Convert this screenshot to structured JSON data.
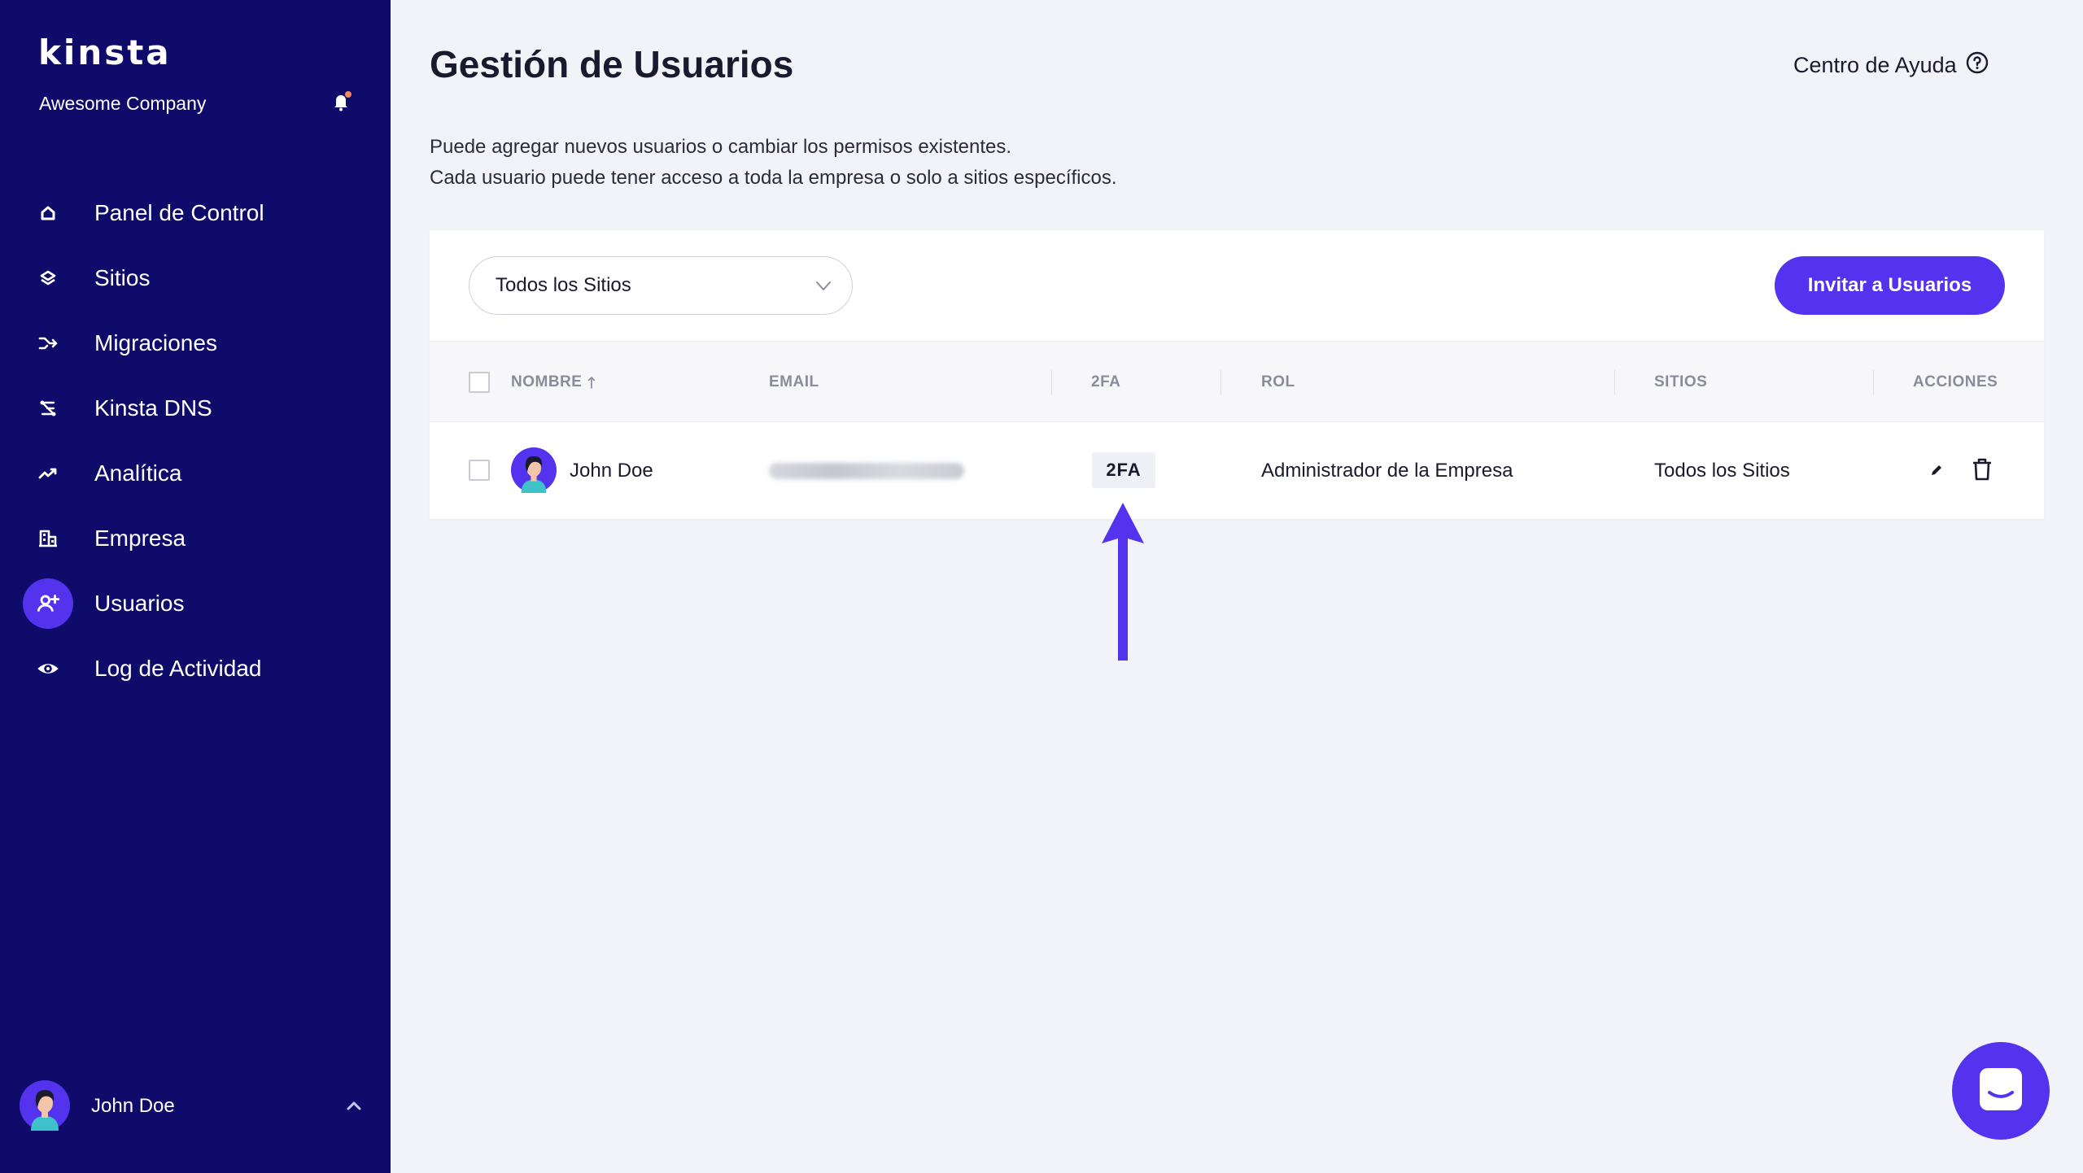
{
  "sidebar": {
    "logo": "kinsta",
    "company": "Awesome Company",
    "items": [
      {
        "label": "Panel de Control",
        "icon": "home-icon"
      },
      {
        "label": "Sitios",
        "icon": "layers-icon"
      },
      {
        "label": "Migraciones",
        "icon": "migrate-icon"
      },
      {
        "label": "Kinsta DNS",
        "icon": "dns-icon"
      },
      {
        "label": "Analítica",
        "icon": "analytics-icon"
      },
      {
        "label": "Empresa",
        "icon": "building-icon"
      },
      {
        "label": "Usuarios",
        "icon": "user-add-icon",
        "active": true
      },
      {
        "label": "Log de Actividad",
        "icon": "eye-icon"
      }
    ],
    "user": {
      "name": "John Doe"
    }
  },
  "header": {
    "title": "Gestión de Usuarios",
    "help": "Centro de Ayuda"
  },
  "description": {
    "line1": "Puede agregar nuevos usuarios o cambiar los permisos existentes.",
    "line2": "Cada usuario puede tener acceso a toda la empresa o solo a sitios específicos."
  },
  "toolbar": {
    "site_filter": "Todos los Sitios",
    "invite_label": "Invitar a Usuarios"
  },
  "table": {
    "columns": {
      "name": "NOMBRE",
      "email": "EMAIL",
      "twofa": "2FA",
      "role": "ROL",
      "sites": "SITIOS",
      "actions": "ACCIONES"
    },
    "rows": [
      {
        "name": "John Doe",
        "twofa": "2FA",
        "role": "Administrador de la Empresa",
        "sites": "Todos los Sitios"
      }
    ]
  },
  "colors": {
    "sidebar": "#0E0B6B",
    "accent": "#5333ED",
    "background": "#F2F3F8"
  }
}
